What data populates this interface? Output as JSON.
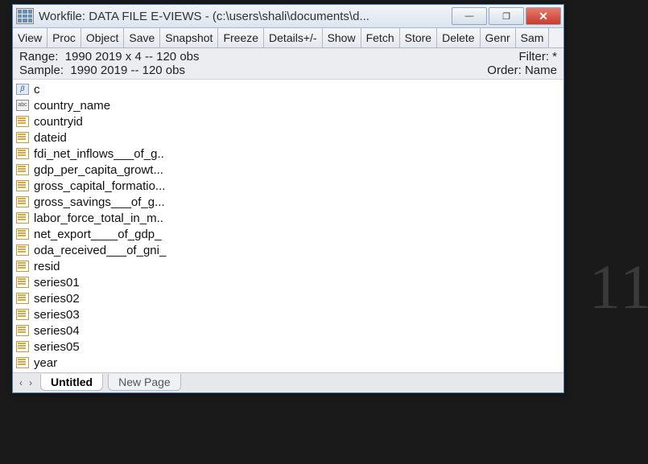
{
  "title": "Workfile: DATA FILE E-VIEWS  -  (c:\\users\\shali\\documents\\d...",
  "win_controls": {
    "minimize": "—",
    "maximize": "❐",
    "close": "✕"
  },
  "toolbar": [
    "View",
    "Proc",
    "Object",
    "Save",
    "Snapshot",
    "Freeze",
    "Details+/-",
    "Show",
    "Fetch",
    "Store",
    "Delete",
    "Genr",
    "Sam"
  ],
  "info": {
    "range_label": "Range:",
    "range_value": "1990 2019 x 4   --   120 obs",
    "filter_label": "Filter: *",
    "sample_label": "Sample:",
    "sample_value": "1990 2019   --   120 obs",
    "order_label": "Order: Name"
  },
  "objects": [
    {
      "icon": "beta",
      "name": "c"
    },
    {
      "icon": "alpha",
      "name": "country_name"
    },
    {
      "icon": "series",
      "name": "countryid"
    },
    {
      "icon": "series",
      "name": "dateid"
    },
    {
      "icon": "series",
      "name": "fdi_net_inflows___of_g.."
    },
    {
      "icon": "series",
      "name": "gdp_per_capita_growt..."
    },
    {
      "icon": "series",
      "name": "gross_capital_formatio..."
    },
    {
      "icon": "series",
      "name": "gross_savings___of_g..."
    },
    {
      "icon": "series",
      "name": "labor_force_total_in_m.."
    },
    {
      "icon": "series",
      "name": "net_export____of_gdp_"
    },
    {
      "icon": "series",
      "name": "oda_received___of_gni_"
    },
    {
      "icon": "series",
      "name": "resid"
    },
    {
      "icon": "series",
      "name": "series01"
    },
    {
      "icon": "series",
      "name": "series02"
    },
    {
      "icon": "series",
      "name": "series03"
    },
    {
      "icon": "series",
      "name": "series04"
    },
    {
      "icon": "series",
      "name": "series05"
    },
    {
      "icon": "series",
      "name": "year"
    }
  ],
  "nav": {
    "prev": "‹",
    "next": "›"
  },
  "tabs": [
    {
      "label": "Untitled",
      "active": true
    },
    {
      "label": "New Page",
      "active": false
    }
  ],
  "watermark": "11"
}
